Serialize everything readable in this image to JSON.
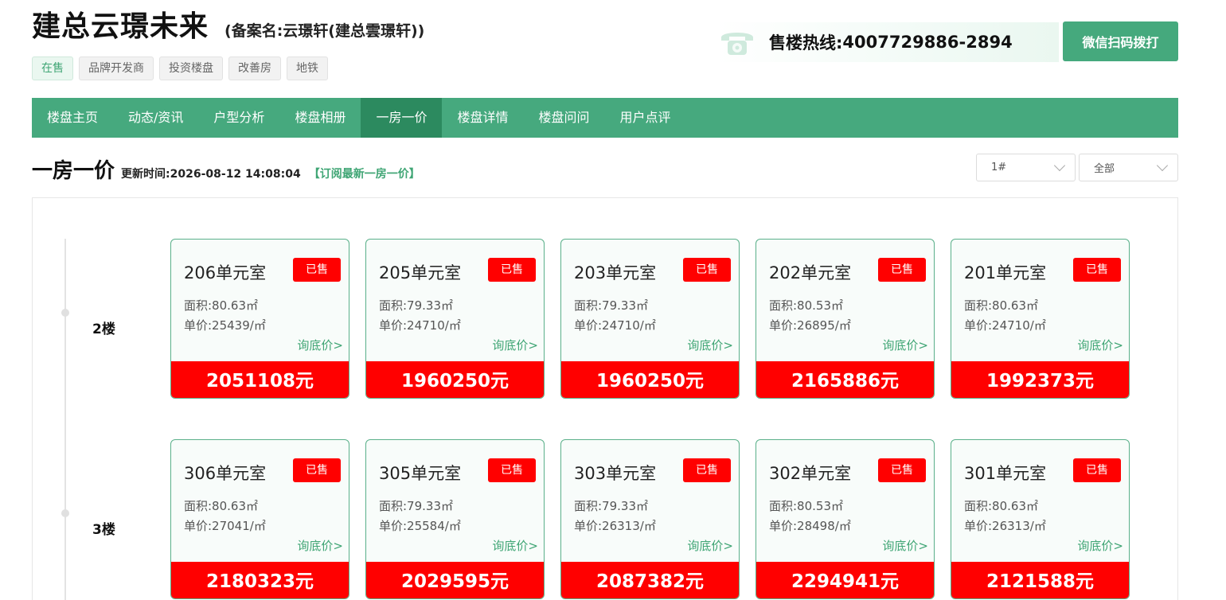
{
  "header": {
    "title": "建总云璟未来",
    "subtitle": "(备案名:云璟轩(建总雲璟轩))",
    "tags": [
      "在售",
      "品牌开发商",
      "投资楼盘",
      "改善房",
      "地铁"
    ],
    "hotline_label": "售楼热线:",
    "hotline_number": "4007729886-2894",
    "wechat_button": "微信扫码拨打",
    "accent_color": "#46a97e"
  },
  "nav": {
    "items": [
      "楼盘主页",
      "动态/资讯",
      "户型分析",
      "楼盘相册",
      "一房一价",
      "楼盘详情",
      "楼盘问问",
      "用户点评"
    ],
    "active": "一房一价"
  },
  "section": {
    "title": "一房一价",
    "update_label": "更新时间:",
    "update_time": "2026-08-12 14:08:04",
    "subscribe_link": "【订阅最新一房一价】",
    "building_select": "1#",
    "filter_select": "全部"
  },
  "floors": [
    {
      "label": "2楼",
      "units": [
        {
          "room": "206单元室",
          "status": "已售",
          "area": "面积:80.63㎡",
          "unit_price": "单价:25439/㎡",
          "inquiry": "询底价>",
          "total": "2051108元"
        },
        {
          "room": "205单元室",
          "status": "已售",
          "area": "面积:79.33㎡",
          "unit_price": "单价:24710/㎡",
          "inquiry": "询底价>",
          "total": "1960250元"
        },
        {
          "room": "203单元室",
          "status": "已售",
          "area": "面积:79.33㎡",
          "unit_price": "单价:24710/㎡",
          "inquiry": "询底价>",
          "total": "1960250元"
        },
        {
          "room": "202单元室",
          "status": "已售",
          "area": "面积:80.53㎡",
          "unit_price": "单价:26895/㎡",
          "inquiry": "询底价>",
          "total": "2165886元"
        },
        {
          "room": "201单元室",
          "status": "已售",
          "area": "面积:80.63㎡",
          "unit_price": "单价:24710/㎡",
          "inquiry": "询底价>",
          "total": "1992373元"
        }
      ]
    },
    {
      "label": "3楼",
      "units": [
        {
          "room": "306单元室",
          "status": "已售",
          "area": "面积:80.63㎡",
          "unit_price": "单价:27041/㎡",
          "inquiry": "询底价>",
          "total": "2180323元"
        },
        {
          "room": "305单元室",
          "status": "已售",
          "area": "面积:79.33㎡",
          "unit_price": "单价:25584/㎡",
          "inquiry": "询底价>",
          "total": "2029595元"
        },
        {
          "room": "303单元室",
          "status": "已售",
          "area": "面积:79.33㎡",
          "unit_price": "单价:26313/㎡",
          "inquiry": "询底价>",
          "total": "2087382元"
        },
        {
          "room": "302单元室",
          "status": "已售",
          "area": "面积:80.53㎡",
          "unit_price": "单价:28498/㎡",
          "inquiry": "询底价>",
          "total": "2294941元"
        },
        {
          "room": "301单元室",
          "status": "已售",
          "area": "面积:80.63㎡",
          "unit_price": "单价:26313/㎡",
          "inquiry": "询底价>",
          "total": "2121588元"
        }
      ]
    }
  ]
}
